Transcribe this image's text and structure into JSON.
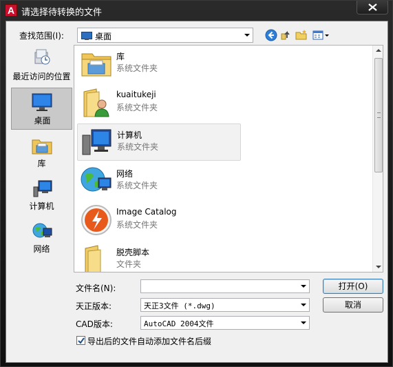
{
  "window": {
    "title": "请选择待转换的文件"
  },
  "lookin": {
    "label": "查找范围(I):",
    "value": "桌面"
  },
  "toolbar": {
    "icons": [
      "back-icon",
      "up-folder-icon",
      "new-folder-icon",
      "view-menu-icon"
    ]
  },
  "places": [
    {
      "label": "最近访问的位置",
      "icon": "recent-places-icon"
    },
    {
      "label": "桌面",
      "icon": "desktop-icon",
      "selected": true
    },
    {
      "label": "库",
      "icon": "libraries-icon"
    },
    {
      "label": "计算机",
      "icon": "computer-icon"
    },
    {
      "label": "网络",
      "icon": "network-icon"
    }
  ],
  "files": [
    {
      "name": "库",
      "type": "系统文件夹",
      "icon": "libraries-icon"
    },
    {
      "name": "kuaitukeji",
      "type": "系统文件夹",
      "icon": "user-folder-icon"
    },
    {
      "name": "计算机",
      "type": "系统文件夹",
      "icon": "computer-icon",
      "hover": true
    },
    {
      "name": "网络",
      "type": "系统文件夹",
      "icon": "network-icon"
    },
    {
      "name": "Image Catalog",
      "type": "系统文件夹",
      "icon": "image-catalog-icon"
    },
    {
      "name": "脱壳脚本",
      "type": "文件夹",
      "icon": "folder-icon"
    }
  ],
  "form": {
    "filename_label": "文件名(N):",
    "filename_value": "",
    "tangent_label": "天正版本:",
    "tangent_value": "天正3文件 (*.dwg)",
    "cad_label": "CAD版本:",
    "cad_value": "AutoCAD 2004文件",
    "open_button": "打开(O)",
    "cancel_button": "取消",
    "suffix_checkbox_label": "导出后的文件自动添加文件名后缀",
    "suffix_checked": true
  },
  "colors": {
    "title_bar": "#1a1a1a",
    "client_bg": "#f0f0f0",
    "selected_place": "#c9c9c9",
    "accent": "#3c7fb1"
  }
}
